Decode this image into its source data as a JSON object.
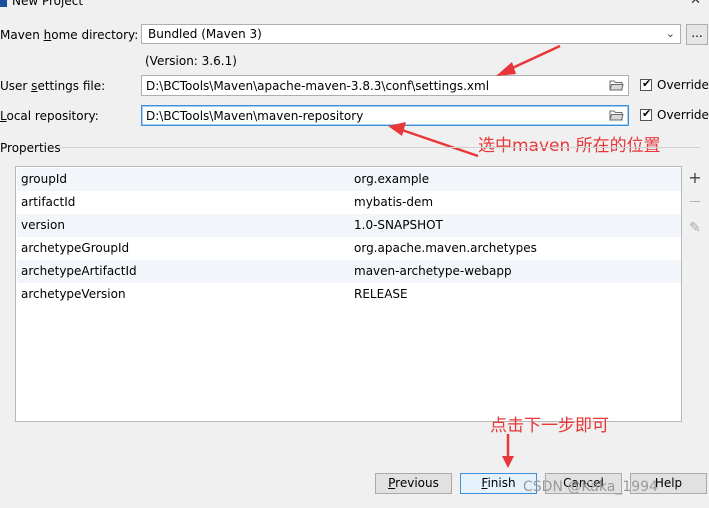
{
  "window": {
    "title": "New Project"
  },
  "maven_home": {
    "label_pre": "Maven ",
    "label_ul": "h",
    "label_post": "ome directory:",
    "value": "Bundled (Maven 3)",
    "more_label": "...",
    "version_text": "(Version: 3.6.1)"
  },
  "user_settings": {
    "label_pre": "User ",
    "label_ul": "s",
    "label_post": "ettings file:",
    "value": "D:\\BCTools\\Maven\\apache-maven-3.8.3\\conf\\settings.xml",
    "override_label": "Override",
    "override_checked": true
  },
  "local_repo": {
    "label_pre": "",
    "label_ul": "L",
    "label_post": "ocal repository:",
    "value": "D:\\BCTools\\Maven\\maven-repository",
    "override_label": "Override",
    "override_checked": true
  },
  "properties": {
    "section_label": "Properties",
    "rows": [
      {
        "key": "groupId",
        "value": "org.example"
      },
      {
        "key": "artifactId",
        "value": "mybatis-dem"
      },
      {
        "key": "version",
        "value": "1.0-SNAPSHOT"
      },
      {
        "key": "archetypeGroupId",
        "value": "org.apache.maven.archetypes"
      },
      {
        "key": "archetypeArtifactId",
        "value": "maven-archetype-webapp"
      },
      {
        "key": "archetypeVersion",
        "value": "RELEASE"
      }
    ],
    "tools": {
      "add": "+",
      "remove": "—",
      "edit": "✎"
    }
  },
  "annotations": {
    "select_location": "选中maven 所在的位置",
    "click_next": "点击下一步即可"
  },
  "buttons": {
    "previous_ul": "P",
    "previous_rest": "revious",
    "finish_ul": "F",
    "finish_rest": "inish",
    "cancel": "Cancel",
    "help": "Help"
  },
  "watermark": "CSDN @Kaka_1994",
  "colors": {
    "annotation_red": "#e8373a",
    "focus_blue": "#3d8fd8"
  }
}
